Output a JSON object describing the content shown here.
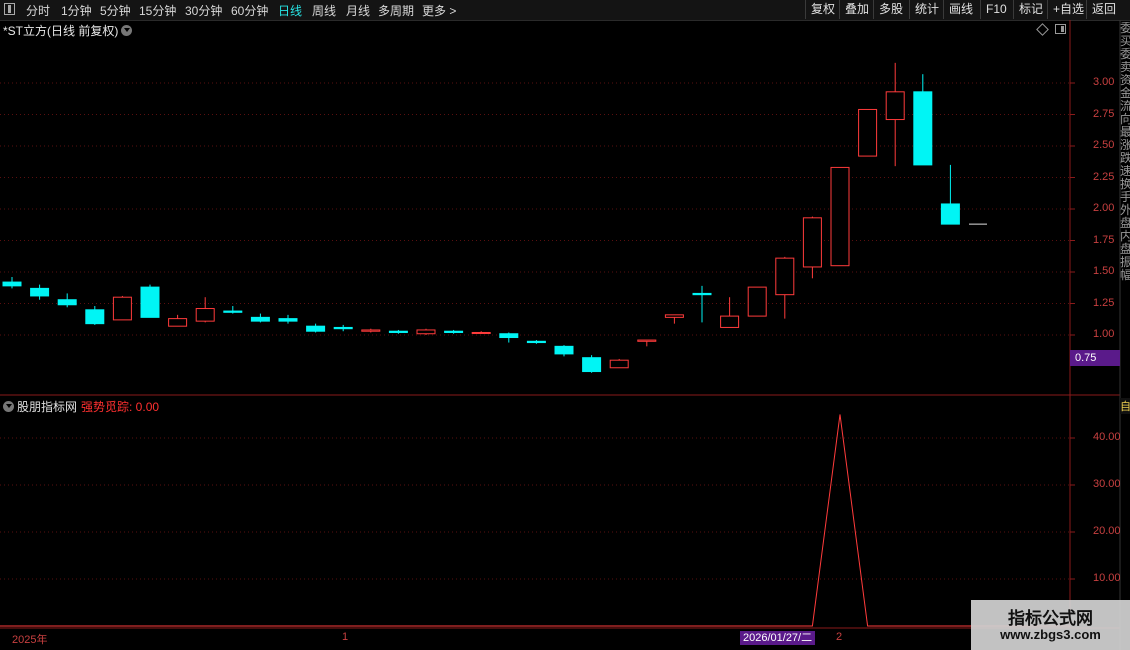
{
  "toolbar": {
    "periods": [
      "分时",
      "1分钟",
      "5分钟",
      "15分钟",
      "30分钟",
      "60分钟",
      "日线",
      "周线",
      "月线",
      "多周期",
      "更多"
    ],
    "active_period": "日线",
    "right_buttons": [
      "复权",
      "叠加",
      "多股",
      "统计",
      "画线",
      "F10",
      "标记",
      "+自选",
      "返回"
    ]
  },
  "main_chart": {
    "title": "*ST立方(日线 前复权)",
    "current_price_badge": "0.75",
    "right_vertical_text": "委买委卖资金流向最涨跌速换手外盘内盘振幅",
    "colors": {
      "up": "#ff3b3b",
      "down": "#00f5f5",
      "grid": "#5a0f0f",
      "axis_text": "#c84040"
    }
  },
  "chart_data": [
    {
      "type": "candlestick",
      "y_ticks": [
        3.0,
        2.75,
        2.5,
        2.25,
        2.0,
        1.75,
        1.5,
        1.25,
        1.0
      ],
      "ylim": [
        0.7,
        3.2
      ],
      "candles": [
        {
          "o": 1.42,
          "h": 1.46,
          "l": 1.37,
          "c": 1.39
        },
        {
          "o": 1.37,
          "h": 1.4,
          "l": 1.28,
          "c": 1.31
        },
        {
          "o": 1.28,
          "h": 1.33,
          "l": 1.22,
          "c": 1.24
        },
        {
          "o": 1.2,
          "h": 1.23,
          "l": 1.08,
          "c": 1.09
        },
        {
          "o": 1.12,
          "h": 1.31,
          "l": 1.12,
          "c": 1.3
        },
        {
          "o": 1.38,
          "h": 1.4,
          "l": 1.14,
          "c": 1.14
        },
        {
          "o": 1.07,
          "h": 1.16,
          "l": 1.07,
          "c": 1.13
        },
        {
          "o": 1.11,
          "h": 1.3,
          "l": 1.1,
          "c": 1.21
        },
        {
          "o": 1.19,
          "h": 1.23,
          "l": 1.17,
          "c": 1.18
        },
        {
          "o": 1.14,
          "h": 1.17,
          "l": 1.1,
          "c": 1.11
        },
        {
          "o": 1.13,
          "h": 1.16,
          "l": 1.09,
          "c": 1.11
        },
        {
          "o": 1.07,
          "h": 1.09,
          "l": 1.02,
          "c": 1.03
        },
        {
          "o": 1.06,
          "h": 1.08,
          "l": 1.03,
          "c": 1.05
        },
        {
          "o": 1.03,
          "h": 1.05,
          "l": 1.02,
          "c": 1.04
        },
        {
          "o": 1.03,
          "h": 1.04,
          "l": 1.01,
          "c": 1.02
        },
        {
          "o": 1.01,
          "h": 1.05,
          "l": 1.0,
          "c": 1.04
        },
        {
          "o": 1.03,
          "h": 1.04,
          "l": 1.01,
          "c": 1.02
        },
        {
          "o": 1.02,
          "h": 1.03,
          "l": 1.01,
          "c": 1.02
        },
        {
          "o": 1.01,
          "h": 1.02,
          "l": 0.94,
          "c": 0.98
        },
        {
          "o": 0.95,
          "h": 0.96,
          "l": 0.93,
          "c": 0.94
        },
        {
          "o": 0.91,
          "h": 0.92,
          "l": 0.83,
          "c": 0.85
        },
        {
          "o": 0.82,
          "h": 0.84,
          "l": 0.7,
          "c": 0.71
        },
        {
          "o": 0.74,
          "h": 0.81,
          "l": 0.74,
          "c": 0.8
        },
        {
          "o": 0.95,
          "h": 0.96,
          "l": 0.91,
          "c": 0.96
        },
        {
          "o": 1.14,
          "h": 1.16,
          "l": 1.09,
          "c": 1.16
        },
        {
          "o": 1.33,
          "h": 1.39,
          "l": 1.1,
          "c": 1.32
        },
        {
          "o": 1.06,
          "h": 1.3,
          "l": 1.06,
          "c": 1.15
        },
        {
          "o": 1.15,
          "h": 1.38,
          "l": 1.15,
          "c": 1.38
        },
        {
          "o": 1.32,
          "h": 1.62,
          "l": 1.13,
          "c": 1.61
        },
        {
          "o": 1.54,
          "h": 1.94,
          "l": 1.45,
          "c": 1.93
        },
        {
          "o": 1.55,
          "h": 2.33,
          "l": 1.55,
          "c": 2.33
        },
        {
          "o": 2.42,
          "h": 2.79,
          "l": 2.42,
          "c": 2.79
        },
        {
          "o": 2.71,
          "h": 3.16,
          "l": 2.34,
          "c": 2.93
        },
        {
          "o": 2.93,
          "h": 3.07,
          "l": 2.35,
          "c": 2.35
        },
        {
          "o": 2.04,
          "h": 2.35,
          "l": 1.88,
          "c": 1.88
        },
        {
          "o": 1.88,
          "h": 1.88,
          "l": 1.88,
          "c": 1.88
        }
      ]
    },
    {
      "type": "line",
      "name": "强势觅踪",
      "y_ticks": [
        40.0,
        30.0,
        20.0,
        10.0
      ],
      "ylim": [
        -1,
        48
      ],
      "values": [
        0,
        0,
        0,
        0,
        0,
        0,
        0,
        0,
        0,
        0,
        0,
        0,
        0,
        0,
        0,
        0,
        0,
        0,
        0,
        0,
        0,
        0,
        0,
        0,
        0,
        0,
        0,
        0,
        0,
        0,
        45,
        0,
        0,
        0,
        0,
        0
      ]
    }
  ],
  "indicator": {
    "title": "股朋指标网",
    "series_label": "强势觅踪: 0.00",
    "corner_flag": "自"
  },
  "x_axis": {
    "labels": [
      "2025年",
      "1",
      "2"
    ],
    "cursor_date": "2026/01/27/二"
  },
  "watermark": {
    "line1": "指标公式网",
    "line2": "www.zbgs3.com"
  }
}
